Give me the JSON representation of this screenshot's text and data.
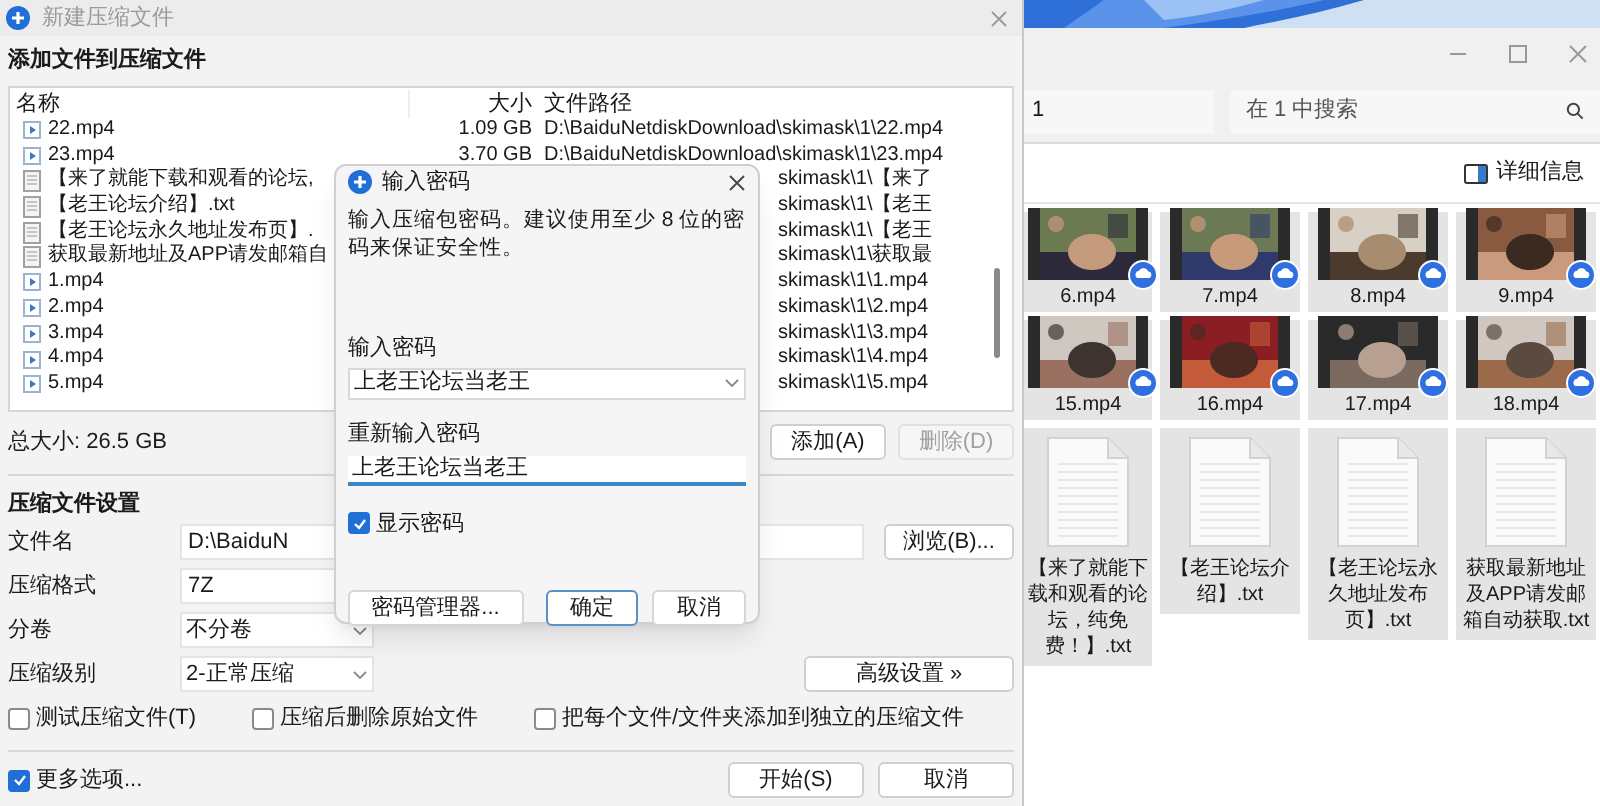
{
  "archive_window": {
    "title": "新建压缩文件",
    "heading": "添加文件到压缩文件",
    "file_list": {
      "columns": [
        "名称",
        "大小",
        "文件路径"
      ],
      "rows": [
        {
          "kind": "video",
          "name": "22.mp4",
          "size": "1.09 GB",
          "path": "D:\\BaiduNetdiskDownload\\skimask\\1\\22.mp4"
        },
        {
          "kind": "video",
          "name": "23.mp4",
          "size": "3.70 GB",
          "path": "D:\\BaiduNetdiskDownload\\skimask\\1\\23.mp4"
        },
        {
          "kind": "text",
          "name": "【来了就能下载和观看的论坛,",
          "path": "skimask\\1\\【来了"
        },
        {
          "kind": "text",
          "name": "【老王论坛介绍】.txt",
          "path": "skimask\\1\\【老王"
        },
        {
          "kind": "text",
          "name": "【老王论坛永久地址发布页】.",
          "path": "skimask\\1\\【老王"
        },
        {
          "kind": "text",
          "name": "获取最新地址及APP请发邮箱自",
          "path": "skimask\\1\\获取最"
        },
        {
          "kind": "video",
          "name": "1.mp4",
          "path": "skimask\\1\\1.mp4"
        },
        {
          "kind": "video",
          "name": "2.mp4",
          "path": "skimask\\1\\2.mp4"
        },
        {
          "kind": "video",
          "name": "3.mp4",
          "path": "skimask\\1\\3.mp4"
        },
        {
          "kind": "video",
          "name": "4.mp4",
          "path": "skimask\\1\\4.mp4"
        },
        {
          "kind": "video",
          "name": "5.mp4",
          "path": "skimask\\1\\5.mp4"
        }
      ]
    },
    "total_size": "总大小: 26.5 GB",
    "list_buttons": [
      {
        "label": "添加(A)",
        "disabled": false
      },
      {
        "label": "删除(D)",
        "disabled": true
      }
    ],
    "settings": {
      "heading": "压缩文件设置",
      "fields": [
        {
          "kind": "text",
          "label": "文件名",
          "value": "D:\\BaiduN",
          "button": "浏览(B)..."
        },
        {
          "kind": "text",
          "label": "压缩格式",
          "value": "7Z"
        },
        {
          "kind": "select",
          "label": "分卷",
          "value": "不分卷"
        },
        {
          "kind": "select",
          "label": "压缩级别",
          "value": "2-正常压缩",
          "button": "高级设置 »"
        }
      ],
      "options": [
        {
          "label": "测试压缩文件(T)",
          "checked": false
        },
        {
          "label": "压缩后删除原始文件",
          "checked": false
        },
        {
          "label": "把每个文件/文件夹添加到独立的压缩文件",
          "checked": false
        }
      ]
    },
    "more_options": {
      "label": "更多选项...",
      "checked": true
    },
    "buttons": [
      "开始(S)",
      "取消"
    ]
  },
  "password_dialog": {
    "title": "输入密码",
    "message": "输入压缩包密码。建议使用至少 8 位的密码来保证安全性。",
    "password_label": "输入密码",
    "password": "上老王论坛当老王",
    "confirm_label": "重新输入密码",
    "confirm": "上老王论坛当老王",
    "show_password": {
      "label": "显示密码",
      "checked": true
    },
    "buttons": [
      {
        "label": "密码管理器...",
        "default": false
      },
      {
        "label": "确定",
        "default": true
      },
      {
        "label": "取消",
        "default": false
      }
    ]
  },
  "explorer": {
    "address": "1",
    "search_placeholder": "在 1 中搜索",
    "details_button": "详细信息",
    "items": [
      {
        "kind": "video",
        "name": "6.mp4"
      },
      {
        "kind": "video",
        "name": "7.mp4"
      },
      {
        "kind": "video",
        "name": "8.mp4"
      },
      {
        "kind": "video",
        "name": "9.mp4"
      },
      {
        "kind": "video",
        "name": "15.mp4"
      },
      {
        "kind": "video",
        "name": "16.mp4"
      },
      {
        "kind": "video",
        "name": "17.mp4"
      },
      {
        "kind": "video",
        "name": "18.mp4"
      },
      {
        "kind": "text",
        "name": "【来了就能下载和观看的论坛，纯免费！】.txt"
      },
      {
        "kind": "text",
        "name": "【老王论坛介绍】.txt"
      },
      {
        "kind": "text",
        "name": "【老王论坛永久地址发布页】.txt"
      },
      {
        "kind": "text",
        "name": "获取最新地址及APP请发邮箱自动获取.txt"
      }
    ]
  }
}
